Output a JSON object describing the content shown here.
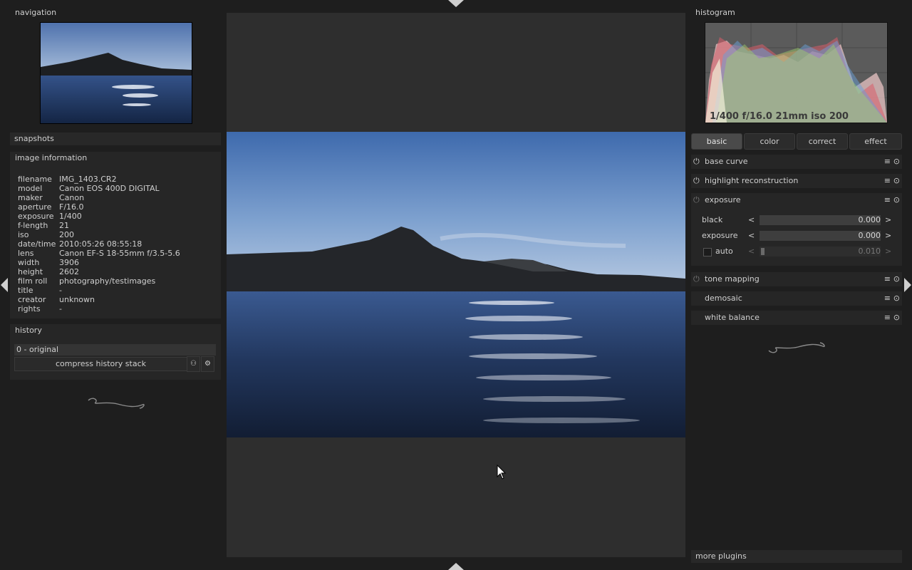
{
  "left": {
    "navigation_title": "navigation",
    "snapshots_title": "snapshots",
    "image_info_title": "image information",
    "image_info": [
      {
        "k": "filename",
        "v": "IMG_1403.CR2"
      },
      {
        "k": "model",
        "v": "Canon EOS 400D DIGITAL"
      },
      {
        "k": "maker",
        "v": "Canon"
      },
      {
        "k": "aperture",
        "v": "F/16.0"
      },
      {
        "k": "exposure",
        "v": "1/400"
      },
      {
        "k": "f-length",
        "v": "21"
      },
      {
        "k": "iso",
        "v": "200"
      },
      {
        "k": "date/time",
        "v": "2010:05:26 08:55:18"
      },
      {
        "k": "lens",
        "v": "Canon EF-S 18-55mm f/3.5-5.6"
      },
      {
        "k": "width",
        "v": "3906"
      },
      {
        "k": "height",
        "v": "2602"
      },
      {
        "k": "film roll",
        "v": "photography/testimages"
      },
      {
        "k": "title",
        "v": "-"
      },
      {
        "k": "creator",
        "v": "unknown"
      },
      {
        "k": "rights",
        "v": "-"
      }
    ],
    "history_title": "history",
    "history_item": "0 - original",
    "compress_button": "compress history stack"
  },
  "right": {
    "histogram_title": "histogram",
    "histogram_overlay": "1/400 f/16.0 21mm iso 200",
    "tabs": [
      "basic",
      "color",
      "correct",
      "effect"
    ],
    "active_tab": "basic",
    "modules": [
      "base curve",
      "highlight reconstruction",
      "exposure",
      "tone mapping",
      "demosaic",
      "white balance"
    ],
    "exposure_sliders": [
      {
        "label": "black",
        "value": "0.000"
      },
      {
        "label": "exposure",
        "value": "0.000"
      },
      {
        "label": "auto",
        "value": "0.010"
      }
    ],
    "more_plugins": "more plugins"
  },
  "colors": {
    "background": "#1e1e1e",
    "panel": "#282828",
    "center": "#2e2e2e"
  }
}
